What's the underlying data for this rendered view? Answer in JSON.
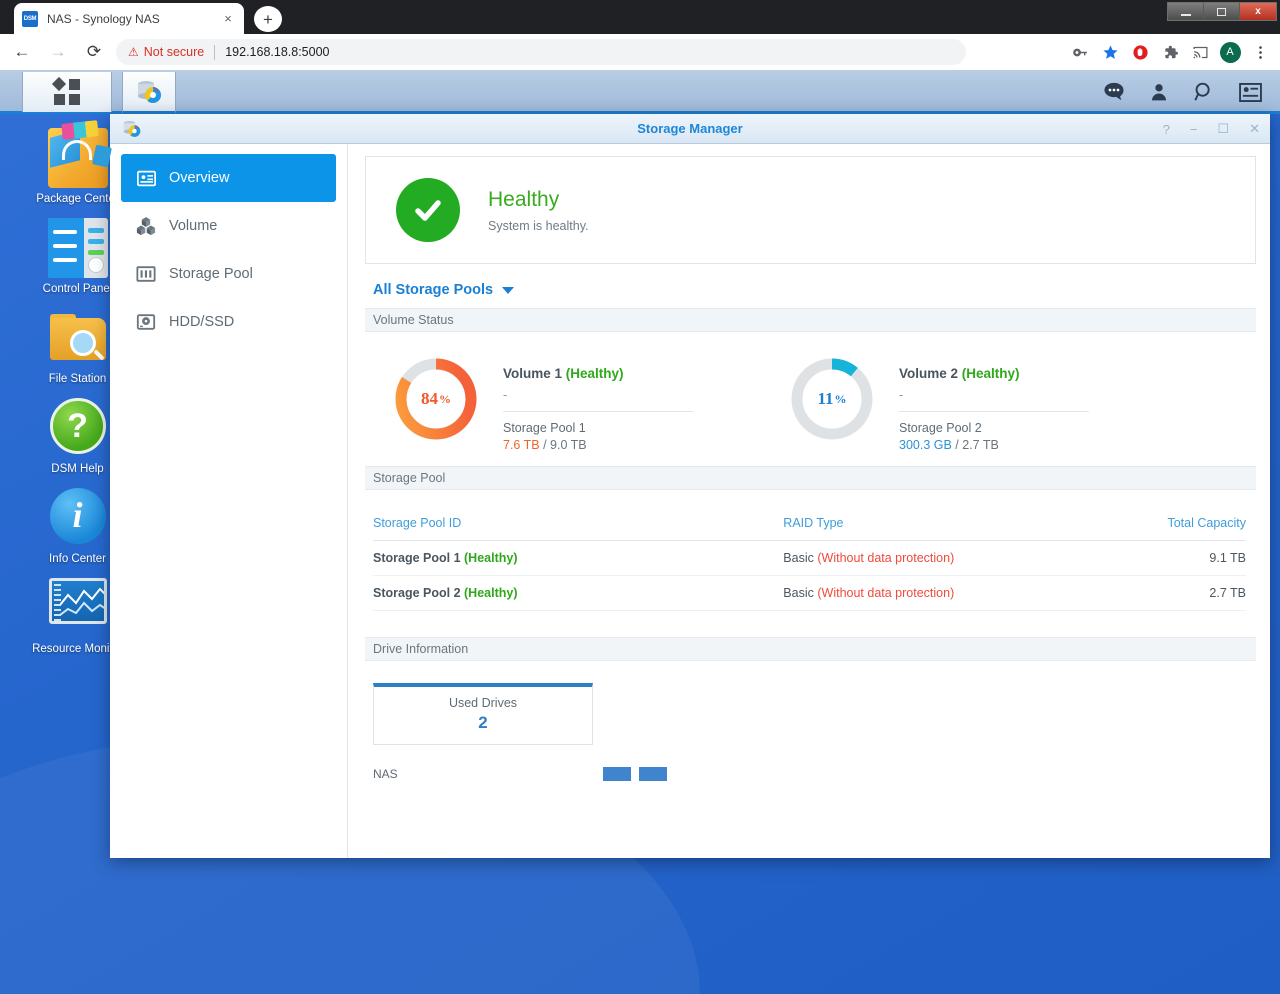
{
  "browser": {
    "tab": {
      "title": "NAS - Synology NAS",
      "favicon_label": "DSM",
      "close_label": "×"
    },
    "new_tab_label": "+",
    "nav": {
      "back": "←",
      "forward": "→",
      "reload": "⟳"
    },
    "omnibox": {
      "warning_icon": "warning-triangle-icon",
      "security_label": "Not secure",
      "url": "192.168.18.8:5000"
    },
    "toolbar_icons": [
      "password-key-icon",
      "bookmark-star-icon",
      "adblock-icon",
      "extensions-puzzle-icon",
      "cast-icon",
      "profile-avatar-icon",
      "chrome-menu-icon"
    ],
    "profile_initial": "A",
    "window_controls": {
      "minimize": "minimize-icon",
      "maximize": "maximize-icon",
      "close": "x"
    }
  },
  "dsm": {
    "taskbar": {
      "main_menu_icon": "dsm-main-menu-icon",
      "app_icon": "storage-manager-taskbar-icon",
      "right_icons": [
        "notifications-icon",
        "user-options-icon",
        "search-icon",
        "widgets-icon"
      ]
    },
    "shortcuts": [
      {
        "label": "Package Center",
        "icon": "package-center-icon"
      },
      {
        "label": "Control Panel",
        "icon": "control-panel-icon"
      },
      {
        "label": "File Station",
        "icon": "file-station-icon"
      },
      {
        "label": "DSM Help",
        "icon": "dsm-help-icon"
      },
      {
        "label": "Info Center",
        "icon": "info-center-icon"
      },
      {
        "label": "Resource Monitor",
        "icon": "resource-monitor-icon"
      }
    ]
  },
  "window": {
    "title": "Storage Manager",
    "controls": {
      "help": "?",
      "minimize": "−",
      "maximize": "☐",
      "close": "✕"
    }
  },
  "sidebar": {
    "items": [
      {
        "label": "Overview",
        "icon": "overview-icon",
        "active": true
      },
      {
        "label": "Volume",
        "icon": "volume-cubes-icon",
        "active": false
      },
      {
        "label": "Storage Pool",
        "icon": "storage-pool-icon",
        "active": false
      },
      {
        "label": "HDD/SSD",
        "icon": "hdd-ssd-icon",
        "active": false
      }
    ]
  },
  "health": {
    "status_icon": "check-circle-icon",
    "title": "Healthy",
    "subtitle": "System is healthy."
  },
  "pool_selector": {
    "label": "All Storage Pools",
    "caret": "chevron-down-icon"
  },
  "sections": {
    "volume_status": "Volume Status",
    "storage_pool": "Storage Pool",
    "drive_information": "Drive Information"
  },
  "volumes": [
    {
      "percent": "84",
      "percent_symbol": "%",
      "percent_value": 84,
      "name": "Volume 1",
      "status": "(Healthy)",
      "description": "-",
      "pool": "Storage Pool 1",
      "used": "7.6 TB",
      "separator": " / ",
      "total": "9.0 TB",
      "color": "#f5813b"
    },
    {
      "percent": "11",
      "percent_symbol": "%",
      "percent_value": 11,
      "name": "Volume 2",
      "status": "(Healthy)",
      "description": "-",
      "pool": "Storage Pool 2",
      "used": "300.3 GB",
      "separator": " / ",
      "total": "2.7 TB",
      "color": "#16b4d8"
    }
  ],
  "pool_table": {
    "headers": [
      "Storage Pool ID",
      "RAID Type",
      "Total Capacity"
    ],
    "rows": [
      {
        "id": "Storage Pool 1",
        "status": "(Healthy)",
        "raid": "Basic",
        "raid_note": "(Without data protection)",
        "capacity": "9.1 TB"
      },
      {
        "id": "Storage Pool 2",
        "status": "(Healthy)",
        "raid": "Basic",
        "raid_note": "(Without data protection)",
        "capacity": "2.7 TB"
      }
    ]
  },
  "drive_info": {
    "card_label": "Used Drives",
    "card_value": "2",
    "enclosure_label": "NAS",
    "slots": 2
  },
  "colors": {
    "accent_blue": "#1b7fd4",
    "healthy_green": "#2fa81b",
    "warn_red": "#ef4b3c",
    "volume1_orange": "#f5813b",
    "volume2_cyan": "#16b4d8",
    "link_blue": "#3e9ddb"
  }
}
